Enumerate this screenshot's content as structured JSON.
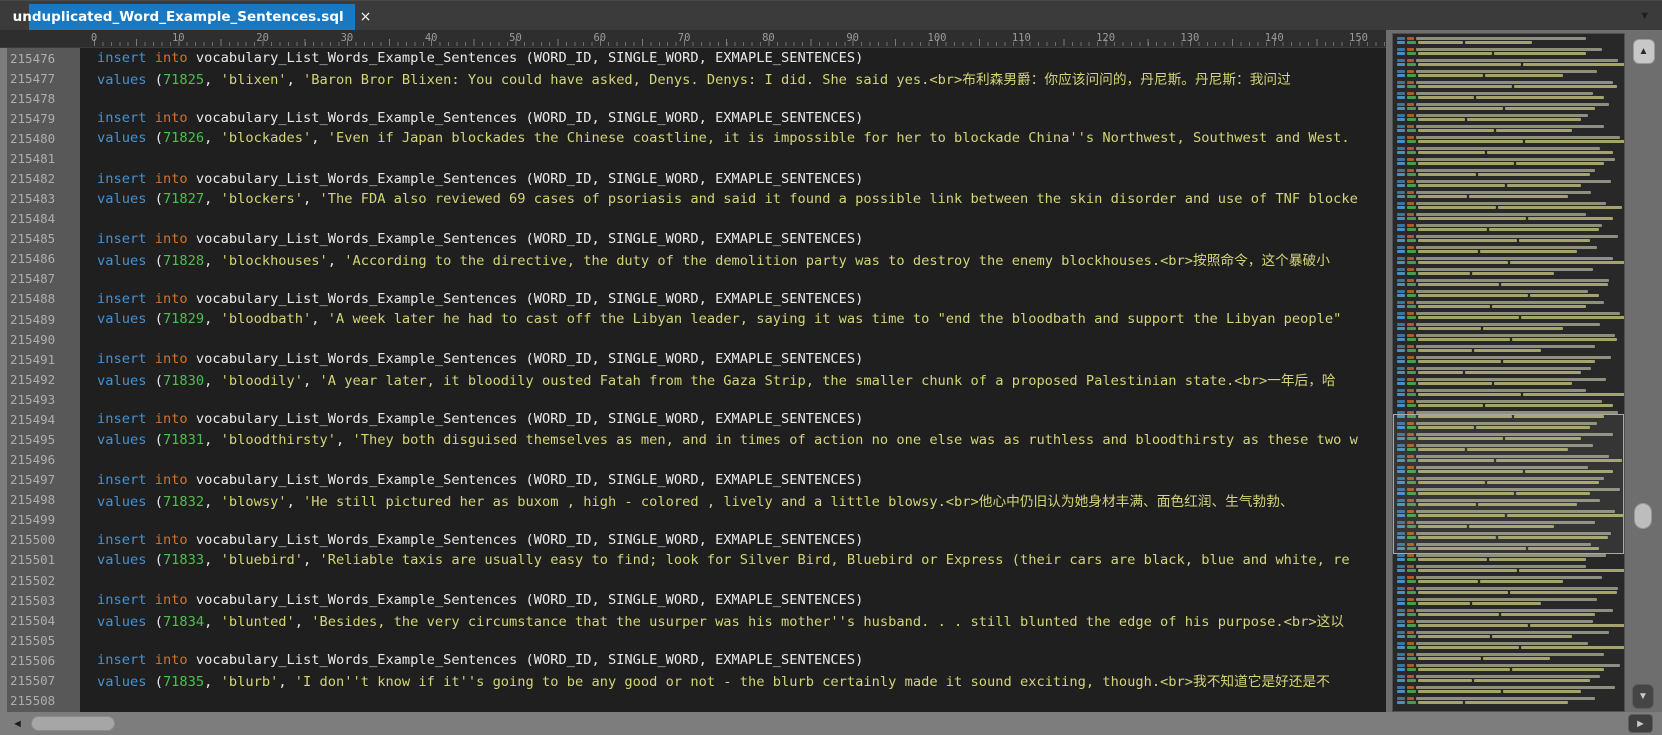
{
  "tab": {
    "title": "unduplicated_Word_Example_Sentences.sql",
    "close_glyph": "×",
    "dropdown_glyph": "▼"
  },
  "ruler": {
    "labels": [
      "0",
      "10",
      "20",
      "30",
      "40",
      "50",
      "60",
      "70",
      "80",
      "90",
      "100",
      "110",
      "120",
      "130",
      "140",
      "150"
    ]
  },
  "editor": {
    "syntax": {
      "insert_kw": "insert",
      "into_kw": "into",
      "insert_rest": " vocabulary_List_Words_Example_Sentences (WORD_ID, SINGLE_WORD, EXMAPLE_SENTENCES)",
      "values_kw": "values"
    },
    "lines": [
      {
        "num": "215476",
        "type": "insert"
      },
      {
        "num": "215477",
        "type": "values",
        "word_id": "71825",
        "word": "blixen",
        "sentence": "Baron Bror Blixen: You could have asked, Denys. Denys: I did. She said yes.<br>布利森男爵：你应该问问的，丹尼斯。丹尼斯：我问过"
      },
      {
        "num": "215478",
        "type": "blank"
      },
      {
        "num": "215479",
        "type": "insert"
      },
      {
        "num": "215480",
        "type": "values",
        "word_id": "71826",
        "word": "blockades",
        "sentence": "Even if Japan blockades the Chinese coastline, it is impossible for her to blockade China''s Northwest, Southwest and West."
      },
      {
        "num": "215481",
        "type": "blank"
      },
      {
        "num": "215482",
        "type": "insert"
      },
      {
        "num": "215483",
        "type": "values",
        "word_id": "71827",
        "word": "blockers",
        "sentence": "The FDA also reviewed 69 cases of psoriasis and said it found a possible link between the skin disorder and use of TNF blocke"
      },
      {
        "num": "215484",
        "type": "blank"
      },
      {
        "num": "215485",
        "type": "insert"
      },
      {
        "num": "215486",
        "type": "values",
        "word_id": "71828",
        "word": "blockhouses",
        "sentence": "According to the directive, the duty of the demolition party was to destroy the enemy blockhouses.<br>按照命令，这个暴破小"
      },
      {
        "num": "215487",
        "type": "blank"
      },
      {
        "num": "215488",
        "type": "insert"
      },
      {
        "num": "215489",
        "type": "values",
        "word_id": "71829",
        "word": "bloodbath",
        "sentence": "A week later he had to cast off the Libyan leader, saying it was time to \"end the bloodbath and support the Libyan people\""
      },
      {
        "num": "215490",
        "type": "blank"
      },
      {
        "num": "215491",
        "type": "insert"
      },
      {
        "num": "215492",
        "type": "values",
        "word_id": "71830",
        "word": "bloodily",
        "sentence": "A year later, it bloodily ousted Fatah from the Gaza Strip, the smaller chunk of a proposed Palestinian state.<br>一年后，哈"
      },
      {
        "num": "215493",
        "type": "blank"
      },
      {
        "num": "215494",
        "type": "insert"
      },
      {
        "num": "215495",
        "type": "values",
        "word_id": "71831",
        "word": "bloodthirsty",
        "sentence": "They both disguised themselves as men, and in times of action no one else was as ruthless and bloodthirsty as these two w"
      },
      {
        "num": "215496",
        "type": "blank"
      },
      {
        "num": "215497",
        "type": "insert"
      },
      {
        "num": "215498",
        "type": "values",
        "word_id": "71832",
        "word": "blowsy",
        "sentence": "He still pictured her as buxom , high - colored , lively and a little blowsy.<br>他心中仍旧认为她身材丰满、面色红润、生气勃勃、"
      },
      {
        "num": "215499",
        "type": "blank"
      },
      {
        "num": "215500",
        "type": "insert"
      },
      {
        "num": "215501",
        "type": "values",
        "word_id": "71833",
        "word": "bluebird",
        "sentence": "Reliable taxis are usually easy to find; look for Silver Bird, Bluebird or Express (their cars are black, blue and white, re"
      },
      {
        "num": "215502",
        "type": "blank"
      },
      {
        "num": "215503",
        "type": "insert"
      },
      {
        "num": "215504",
        "type": "values",
        "word_id": "71834",
        "word": "blunted",
        "sentence": "Besides, the very circumstance that the usurper was his mother''s husband. . . still blunted the edge of his purpose.<br>这以"
      },
      {
        "num": "215505",
        "type": "blank"
      },
      {
        "num": "215506",
        "type": "insert"
      },
      {
        "num": "215507",
        "type": "values",
        "word_id": "71835",
        "word": "blurb",
        "sentence": "I don''t know if it''s going to be any good or not - the blurb certainly made it sound exciting, though.<br>我不知道它是好还是不"
      },
      {
        "num": "215508",
        "type": "blank"
      }
    ]
  },
  "scrollbars": {
    "up_glyph": "▲",
    "down_glyph": "▼",
    "left_glyph": "◄",
    "right_glyph": "►"
  },
  "minimap": {
    "group_count": 61,
    "colors": {
      "insert_kw": "#3f759d",
      "into_kw": "#a95f2c",
      "ident": "#8f8f7f",
      "values_kw": "#4b8fc0",
      "number": "#44a04f",
      "string": "#a3a36a"
    }
  },
  "colors": {
    "tab_active": "#1878c2",
    "editor_bg": "#1f1f1f",
    "keyword_blue": "#4591d3",
    "keyword_orange": "#d3712d",
    "number_green": "#4dbf4d",
    "string_yellow": "#d4d478",
    "gutter_bg": "#585858"
  }
}
